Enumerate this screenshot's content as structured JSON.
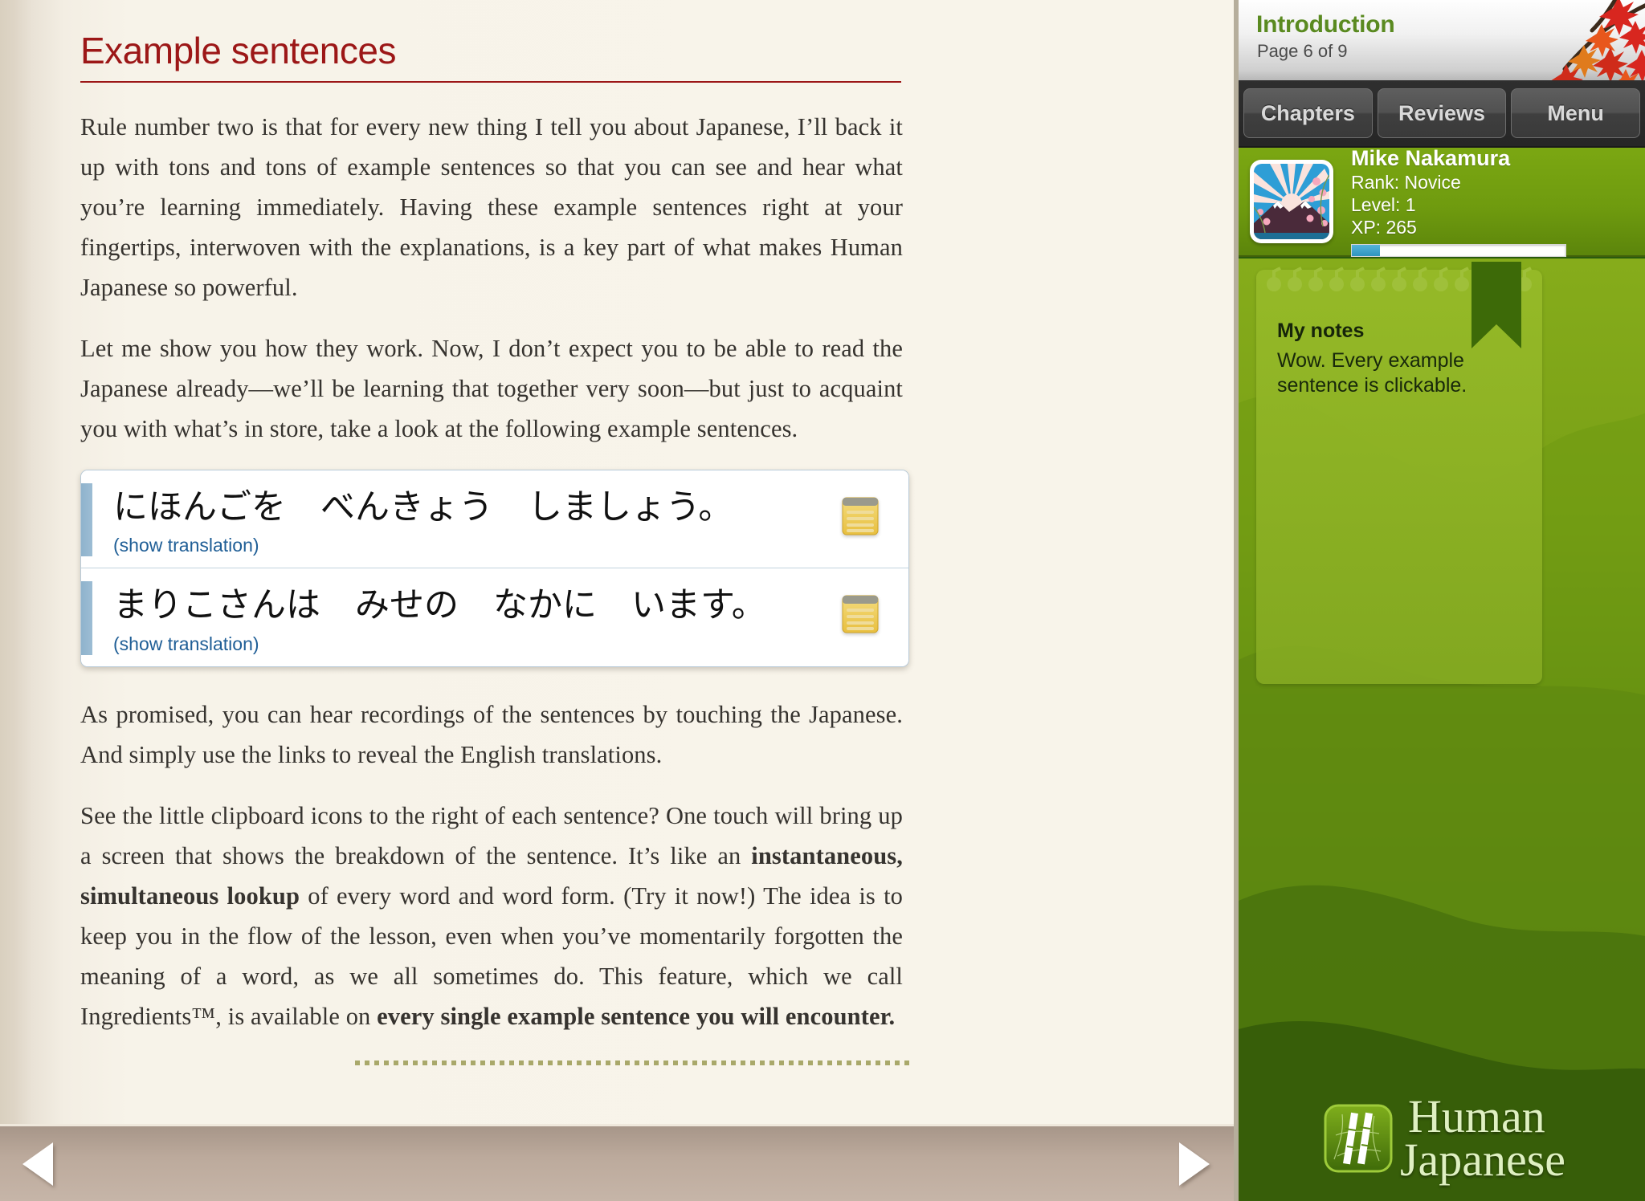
{
  "book": {
    "title": "Example sentences",
    "paragraphs": [
      {
        "id": "p1",
        "html": "Rule number two is that for every new thing I tell you about Japanese, I’ll back it up with tons and tons of example sentences so that you can see and hear what you’re learning immediately. Having these example sentences right at your fingertips, interwoven with the explanations, is a key part of what makes Human Japanese so powerful."
      },
      {
        "id": "p2",
        "html": "Let me show you how they work. Now, I don’t expect you to be able to read the Japanese already—we’ll be learning that together very soon—but just to acquaint you with what’s in store, take a look at the following example sentences."
      },
      {
        "id": "p3",
        "html": "As promised, you can hear recordings of the sentences by touching the Japanese. And simply use the links to reveal the English translations."
      },
      {
        "id": "p4",
        "html": "See the little clipboard icons to the right of each sentence? One touch will bring up a screen that shows the breakdown of the sentence. It’s like an <b>instantaneous, simultaneous lookup</b> of every word and word form. (Try it now!) The idea is to keep you in the flow of the lesson, even when you’ve momentarily forgotten the meaning of a word, as we all sometimes do. This feature, which we call Ingredients™, is available on <b>every single example sentence you will encounter.</b>"
      }
    ],
    "sentences": [
      {
        "japanese": "にほんごを　べんきょう　しましょう。",
        "translation_link": "(show translation)",
        "icon": "clipboard-icon"
      },
      {
        "japanese": "まりこさんは　みせの　なかに　います。",
        "translation_link": "(show translation)",
        "icon": "clipboard-icon"
      }
    ],
    "nav": {
      "prev_label": "Previous page",
      "next_label": "Next page",
      "prev_icon": "triangle-left-icon",
      "next_icon": "triangle-right-icon"
    }
  },
  "sidebar": {
    "header": {
      "chapter": "Introduction",
      "page_indicator": "Page 6 of 9",
      "decoration_icon": "maple-branch-icon"
    },
    "tabs": [
      {
        "label": "Chapters"
      },
      {
        "label": "Reviews"
      },
      {
        "label": "Menu"
      }
    ],
    "profile": {
      "avatar_icon": "mount-fuji-sunrise-avatar",
      "name": "Mike Nakamura",
      "rank": "Rank: Novice",
      "level": "Level: 1",
      "xp": "XP: 265",
      "xp_percent": 13
    },
    "notes": {
      "title": "My notes",
      "body": "Wow. Every example sentence is clickable.",
      "ribbon_icon": "bookmark-ribbon-icon",
      "spiral_icon": "spiral-binding-icon"
    },
    "logo": {
      "mark_icon": "bamboo-logo-icon",
      "line1": "Human",
      "line2": "Japanese"
    }
  },
  "colors": {
    "heading_red": "#9c1717",
    "link_blue": "#1f5e96",
    "chapter_green": "#5a8a20",
    "panel_green": "#6f9b0f",
    "xp_blue": "#2f94c0",
    "page_cream": "#f8f4ea"
  }
}
